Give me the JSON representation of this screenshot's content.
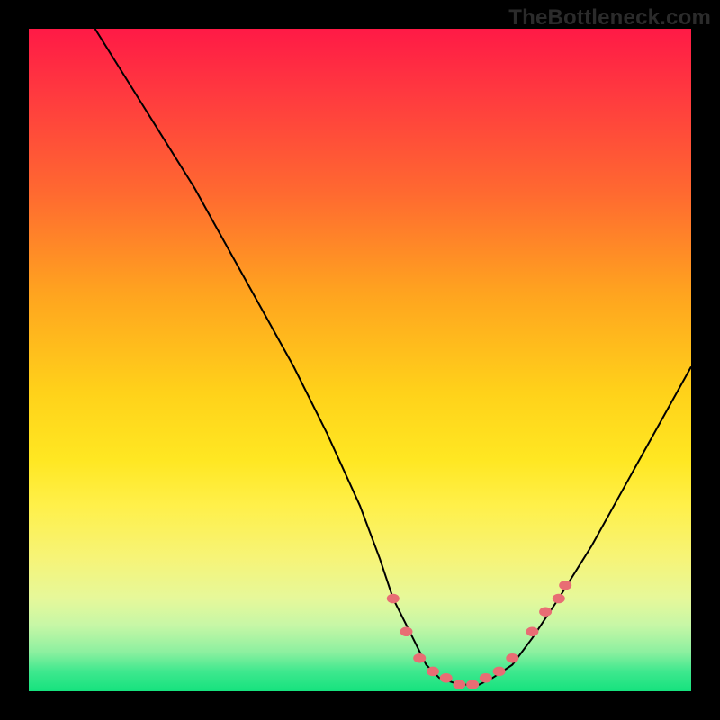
{
  "brand": {
    "label": "TheBottleneck.com"
  },
  "chart_data": {
    "type": "line",
    "title": "",
    "xlabel": "",
    "ylabel": "",
    "xlim": [
      0,
      100
    ],
    "ylim": [
      0,
      100
    ],
    "x": [
      10,
      15,
      20,
      25,
      30,
      35,
      40,
      45,
      50,
      53,
      55,
      58,
      60,
      62,
      65,
      68,
      70,
      73,
      76,
      80,
      85,
      90,
      95,
      100
    ],
    "values": [
      100,
      92,
      84,
      76,
      67,
      58,
      49,
      39,
      28,
      20,
      14,
      8,
      4,
      2,
      1,
      1,
      2,
      4,
      8,
      14,
      22,
      31,
      40,
      49
    ],
    "markers": {
      "x": [
        55,
        57,
        59,
        61,
        63,
        65,
        67,
        69,
        71,
        73,
        76,
        78,
        80,
        81
      ],
      "y": [
        14,
        9,
        5,
        3,
        2,
        1,
        1,
        2,
        3,
        5,
        9,
        12,
        14,
        16
      ],
      "color": "#e86d74",
      "radius": 7
    },
    "gradient_stops": [
      {
        "pos": 0.0,
        "color": "#ff1a46"
      },
      {
        "pos": 0.4,
        "color": "#ffa41f"
      },
      {
        "pos": 0.72,
        "color": "#fff04a"
      },
      {
        "pos": 0.97,
        "color": "#3fe88e"
      },
      {
        "pos": 1.0,
        "color": "#15e27e"
      }
    ]
  }
}
